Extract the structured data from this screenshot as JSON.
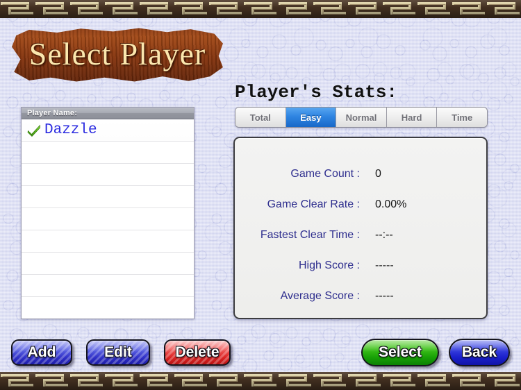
{
  "theme": {
    "background_color": "#dfe1f6",
    "cloud_color": "#838ccd",
    "border_color": "#4a3524",
    "meander_color": "#e8dcae",
    "accent_blue": "#1868c8",
    "label_navy": "#2e2e8e",
    "name_blue": "#2a2ae0"
  },
  "title": {
    "text": "Select Player",
    "sign_style": "wooden-plank"
  },
  "player_list": {
    "header": "Player Name:",
    "rows": [
      {
        "name": "Dazzle",
        "selected": true,
        "icon": "green-check-icon"
      },
      {
        "name": "",
        "selected": false,
        "icon": ""
      },
      {
        "name": "",
        "selected": false,
        "icon": ""
      },
      {
        "name": "",
        "selected": false,
        "icon": ""
      },
      {
        "name": "",
        "selected": false,
        "icon": ""
      },
      {
        "name": "",
        "selected": false,
        "icon": ""
      },
      {
        "name": "",
        "selected": false,
        "icon": ""
      },
      {
        "name": "",
        "selected": false,
        "icon": ""
      },
      {
        "name": "",
        "selected": false,
        "icon": ""
      }
    ]
  },
  "stats": {
    "heading": "Player's Stats:",
    "tabs": [
      {
        "label": "Total",
        "active": false
      },
      {
        "label": "Easy",
        "active": true
      },
      {
        "label": "Normal",
        "active": false
      },
      {
        "label": "Hard",
        "active": false
      },
      {
        "label": "Time",
        "active": false
      }
    ],
    "rows": [
      {
        "label": "Game Count :",
        "value": "0"
      },
      {
        "label": "Game Clear Rate :",
        "value": "0.00%"
      },
      {
        "label": "Fastest Clear Time :",
        "value": "--:--"
      },
      {
        "label": "High Score :",
        "value": "-----"
      },
      {
        "label": "Average Score :",
        "value": "-----"
      }
    ]
  },
  "buttons": {
    "add": "Add",
    "edit": "Edit",
    "delete": "Delete",
    "select": "Select",
    "back": "Back"
  }
}
